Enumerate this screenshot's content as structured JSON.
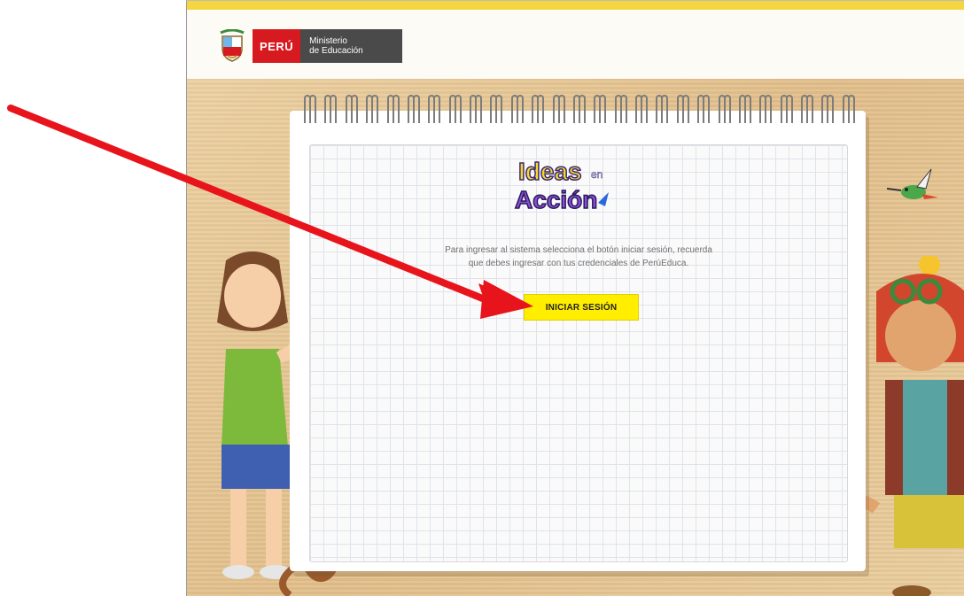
{
  "header": {
    "country": "PERÚ",
    "ministry_line1": "Ministerio",
    "ministry_line2": "de Educación"
  },
  "brand": {
    "logo_line1": "Ideas",
    "logo_small": "en",
    "logo_line2": "Acción"
  },
  "login": {
    "message_line1": "Para ingresar al sistema selecciona el botón iniciar sesión, recuerda",
    "message_line2": "que debes ingresar con tus credenciales de PerúEduca.",
    "button_label": "INICIAR SESIÓN"
  },
  "colors": {
    "accent_yellow": "#ffee00",
    "peru_red": "#d71920",
    "annotation_arrow": "#e8141c"
  }
}
